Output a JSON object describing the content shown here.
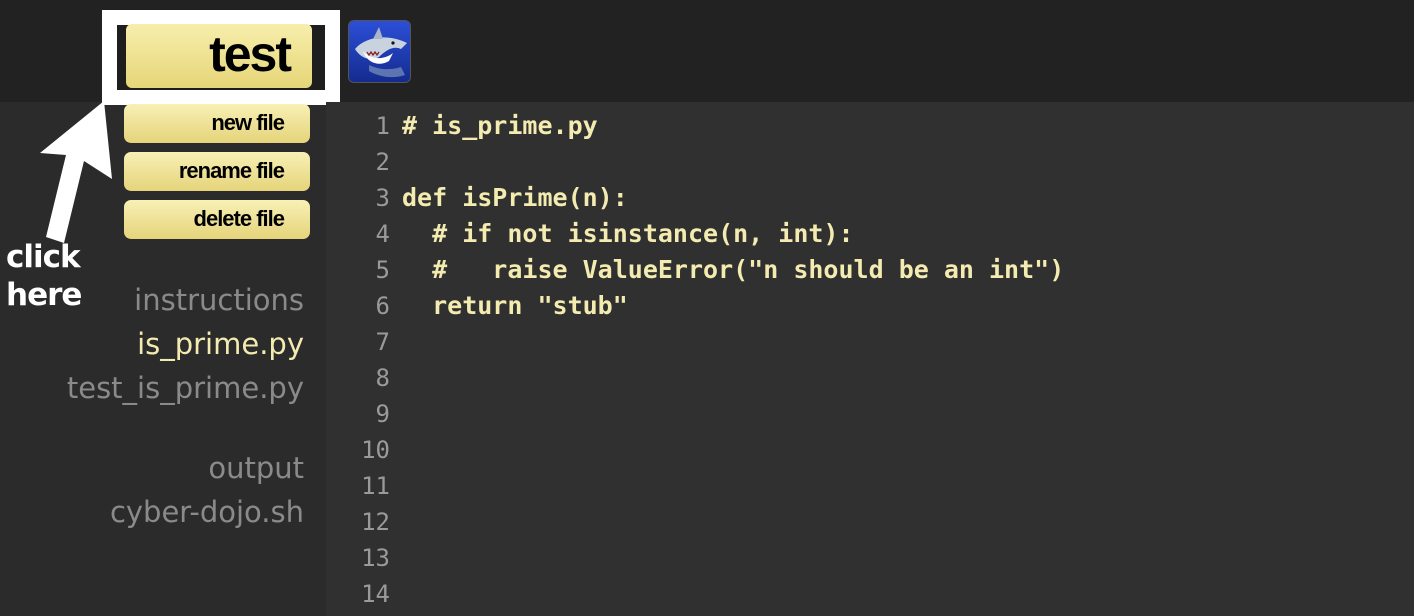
{
  "toolbar": {
    "test_label": "test",
    "avatar_icon": "shark-avatar-icon"
  },
  "file_buttons": {
    "new_file": "new file",
    "rename_file": "rename file",
    "delete_file": "delete file"
  },
  "annotation": {
    "line1": "click",
    "line2": "here",
    "arrow_icon": "arrow-icon"
  },
  "files": {
    "instructions": "instructions",
    "is_prime": "is_prime.py",
    "test_is_prime": "test_is_prime.py",
    "output": "output",
    "cyber_dojo": "cyber-dojo.sh",
    "selected": "is_prime.py"
  },
  "editor": {
    "lines": [
      {
        "num": "1",
        "code": "# is_prime.py"
      },
      {
        "num": "2",
        "code": ""
      },
      {
        "num": "3",
        "code": "def isPrime(n):"
      },
      {
        "num": "4",
        "code": "  # if not isinstance(n, int):"
      },
      {
        "num": "5",
        "code": "  #   raise ValueError(\"n should be an int\")"
      },
      {
        "num": "6",
        "code": "  return \"stub\""
      },
      {
        "num": "7",
        "code": ""
      },
      {
        "num": "8",
        "code": ""
      },
      {
        "num": "9",
        "code": ""
      },
      {
        "num": "10",
        "code": ""
      },
      {
        "num": "11",
        "code": ""
      },
      {
        "num": "12",
        "code": ""
      },
      {
        "num": "13",
        "code": ""
      },
      {
        "num": "14",
        "code": ""
      }
    ]
  },
  "colors": {
    "background": "#2b2b2b",
    "topbar": "#222222",
    "editor_bg": "#303030",
    "button_yellow": "#f3e9a0",
    "code_text": "#f3ebb0",
    "inactive_file": "#8a8a8a",
    "line_number": "#9a9a9a"
  }
}
